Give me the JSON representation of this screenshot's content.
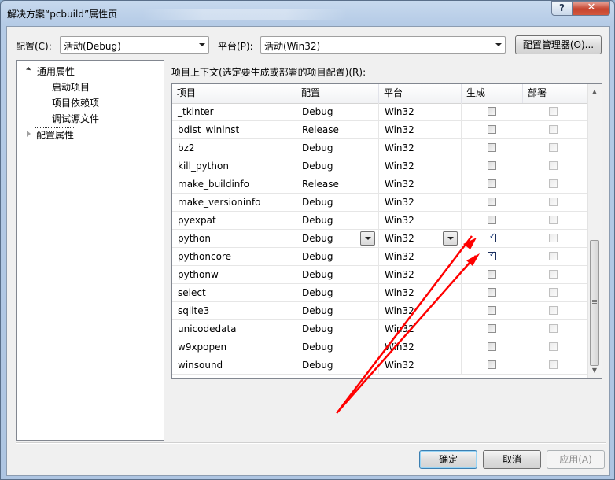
{
  "window": {
    "title": "解决方案“pcbuild”属性页",
    "help_label": "?",
    "close_label": "✕"
  },
  "config_bar": {
    "config_label": "配置(C):",
    "config_value": "活动(Debug)",
    "platform_label": "平台(P):",
    "platform_value": "活动(Win32)",
    "manager_button": "配置管理器(O)..."
  },
  "tree": {
    "items": [
      {
        "label": "通用属性",
        "expanded": true
      },
      {
        "label": "启动项目"
      },
      {
        "label": "项目依赖项"
      },
      {
        "label": "调试源文件"
      },
      {
        "label": "配置属性",
        "expanded": false,
        "selected": true
      }
    ]
  },
  "grid": {
    "caption": "项目上下文(选定要生成或部署的项目配置)(R):",
    "columns": [
      "项目",
      "配置",
      "平台",
      "生成",
      "部署"
    ],
    "rows": [
      {
        "project": "_tkinter",
        "config": "Debug",
        "platform": "Win32",
        "build": false,
        "deploy": false
      },
      {
        "project": "bdist_wininst",
        "config": "Release",
        "platform": "Win32",
        "build": false,
        "deploy": false
      },
      {
        "project": "bz2",
        "config": "Debug",
        "platform": "Win32",
        "build": false,
        "deploy": false
      },
      {
        "project": "kill_python",
        "config": "Debug",
        "platform": "Win32",
        "build": false,
        "deploy": false
      },
      {
        "project": "make_buildinfo",
        "config": "Release",
        "platform": "Win32",
        "build": false,
        "deploy": false
      },
      {
        "project": "make_versioninfo",
        "config": "Debug",
        "platform": "Win32",
        "build": false,
        "deploy": false
      },
      {
        "project": "pyexpat",
        "config": "Debug",
        "platform": "Win32",
        "build": false,
        "deploy": false
      },
      {
        "project": "python",
        "config": "Debug",
        "platform": "Win32",
        "build": true,
        "deploy": false,
        "editing": true
      },
      {
        "project": "pythoncore",
        "config": "Debug",
        "platform": "Win32",
        "build": true,
        "deploy": false
      },
      {
        "project": "pythonw",
        "config": "Debug",
        "platform": "Win32",
        "build": false,
        "deploy": false
      },
      {
        "project": "select",
        "config": "Debug",
        "platform": "Win32",
        "build": false,
        "deploy": false
      },
      {
        "project": "sqlite3",
        "config": "Debug",
        "platform": "Win32",
        "build": false,
        "deploy": false
      },
      {
        "project": "unicodedata",
        "config": "Debug",
        "platform": "Win32",
        "build": false,
        "deploy": false
      },
      {
        "project": "w9xpopen",
        "config": "Debug",
        "platform": "Win32",
        "build": false,
        "deploy": false
      },
      {
        "project": "winsound",
        "config": "Debug",
        "platform": "Win32",
        "build": false,
        "deploy": false
      }
    ]
  },
  "buttons": {
    "ok": "确定",
    "cancel": "取消",
    "apply": "应用(A)"
  },
  "annotation": {
    "color": "#ff0000",
    "shape": "two red arrows pointing at the checked 生成 boxes"
  }
}
